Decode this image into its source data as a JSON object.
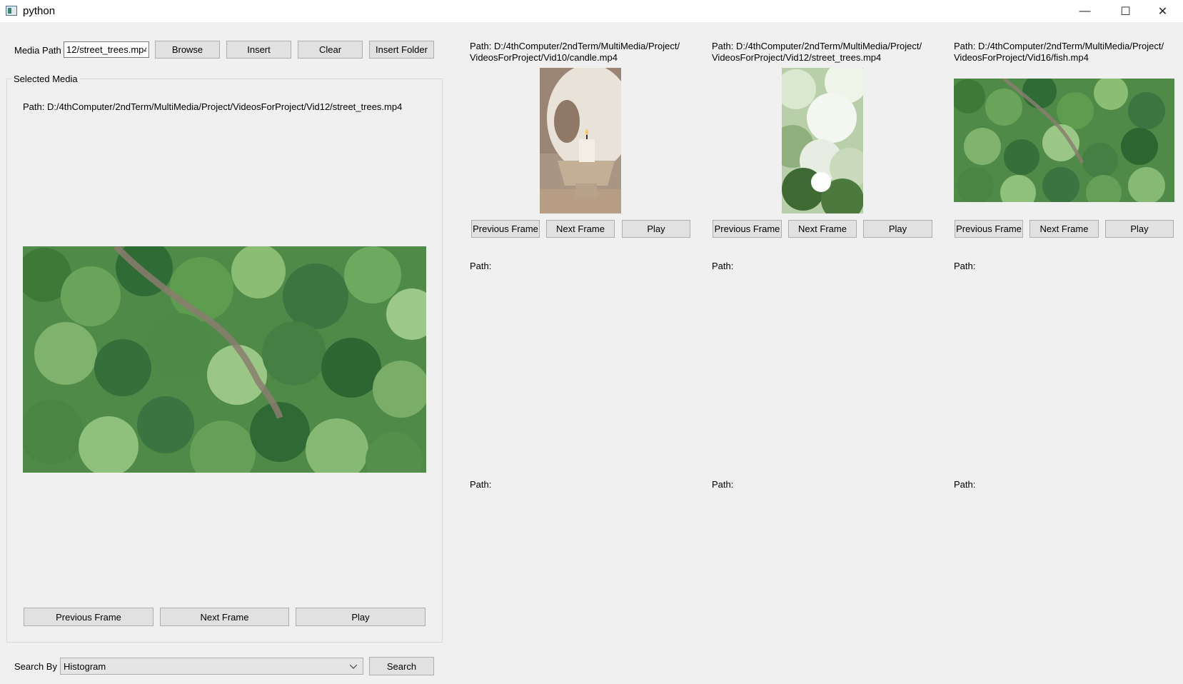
{
  "window": {
    "title": "python",
    "minimize": "—",
    "maximize": "☐",
    "close": "✕"
  },
  "toolbar": {
    "media_path_label": "Media Path",
    "media_path_value": "12/street_trees.mp4",
    "browse": "Browse",
    "insert": "Insert",
    "clear": "Clear",
    "insert_folder": "Insert Folder"
  },
  "selected_media": {
    "title": "Selected Media",
    "path": "Path: D:/4thComputer/2ndTerm/MultiMedia/Project/VideosForProject/Vid12/street_trees.mp4",
    "prev": "Previous Frame",
    "next": "Next Frame",
    "play": "Play"
  },
  "search": {
    "label": "Search By",
    "option": "Histogram",
    "button": "Search"
  },
  "results": [
    {
      "path_line1": "Path: D:/4thComputer/2ndTerm/MultiMedia/Project/",
      "path_line2": "VideosForProject/Vid10/candle.mp4",
      "prev": "Previous Frame",
      "next": "Next Frame",
      "play": "Play"
    },
    {
      "path_line1": "Path: D:/4thComputer/2ndTerm/MultiMedia/Project/",
      "path_line2": "VideosForProject/Vid12/street_trees.mp4",
      "prev": "Previous Frame",
      "next": "Next Frame",
      "play": "Play"
    },
    {
      "path_line1": "Path: D:/4thComputer/2ndTerm/MultiMedia/Project/",
      "path_line2": "VideosForProject/Vid16/fish.mp4",
      "prev": "Previous Frame",
      "next": "Next Frame",
      "play": "Play"
    }
  ],
  "empty_paths": {
    "row2": [
      "Path:",
      "Path:",
      "Path:"
    ],
    "row3": [
      "Path:",
      "Path:",
      "Path:"
    ]
  }
}
